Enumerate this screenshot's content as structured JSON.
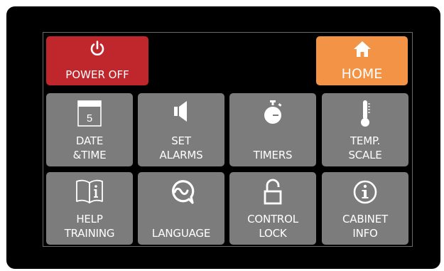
{
  "colors": {
    "power": "#c0272d",
    "home": "#f29345",
    "tile": "#7c7c7c",
    "background": "#000000",
    "text": "#ffffff"
  },
  "top_buttons": {
    "power": {
      "label": "POWER OFF",
      "icon": "power-icon"
    },
    "home": {
      "label": "HOME",
      "icon": "home-icon"
    }
  },
  "tiles": [
    {
      "line1": "DATE",
      "line2": "&TIME",
      "icon": "calendar-icon",
      "calendar_day": "5"
    },
    {
      "line1": "SET",
      "line2": "ALARMS",
      "icon": "speaker-icon"
    },
    {
      "line1": "",
      "line2": "TIMERS",
      "icon": "stopwatch-icon"
    },
    {
      "line1": "TEMP.",
      "line2": "SCALE",
      "icon": "thermometer-icon"
    },
    {
      "line1": "HELP",
      "line2": "TRAINING",
      "icon": "book-info-icon"
    },
    {
      "line1": "",
      "line2": "LANGUAGE",
      "icon": "language-bubble-icon"
    },
    {
      "line1": "CONTROL",
      "line2": "LOCK",
      "icon": "unlock-icon"
    },
    {
      "line1": "CABINET",
      "line2": "INFO",
      "icon": "info-icon"
    }
  ]
}
